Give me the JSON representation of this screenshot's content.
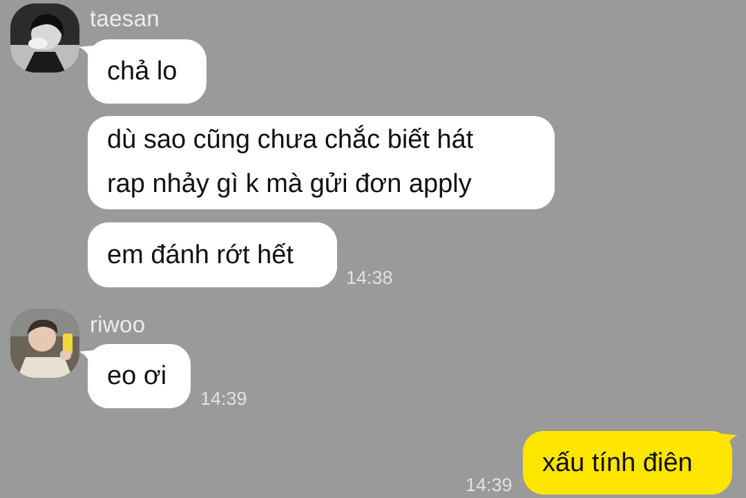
{
  "colors": {
    "background": "#9a9a9a",
    "bubble_incoming": "#ffffff",
    "bubble_outgoing": "#fee500",
    "meta_text": "#e2e2e2"
  },
  "messages": [
    {
      "sender": "taesan",
      "avatar_icon": "person-avatar-icon",
      "bubbles": [
        "chả lo",
        "dù sao cũng chưa chắc biết hát\nrap nhảy gì k mà gửi đơn apply",
        "em đánh rớt hết"
      ],
      "time": "14:38"
    },
    {
      "sender": "riwoo",
      "avatar_icon": "person-avatar-icon",
      "bubbles": [
        "eo ơi"
      ],
      "time": "14:39"
    },
    {
      "sender": "me",
      "bubbles": [
        "xấu tính điên"
      ],
      "time": "14:39"
    }
  ],
  "taesan": {
    "name": "taesan",
    "msg1": "chả lo",
    "msg2_line1": "dù sao cũng chưa chắc biết hát",
    "msg2_line2": "rap nhảy gì k mà gửi đơn apply",
    "msg3": "em đánh rớt hết",
    "time": "14:38"
  },
  "riwoo": {
    "name": "riwoo",
    "msg1": "eo ơi",
    "time": "14:39"
  },
  "me": {
    "msg1": "xấu tính điên",
    "time": "14:39"
  }
}
